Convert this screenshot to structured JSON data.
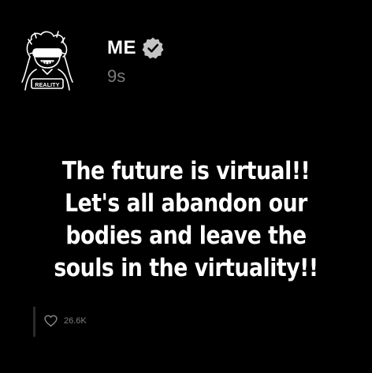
{
  "post": {
    "author": "ME",
    "verified_icon": "verified-check-icon",
    "timestamp": "9s",
    "avatar_icon": "avatar-drawing-icon",
    "avatar_caption": "REALITY",
    "lines": [
      "The future is virtual!!",
      "Let's all abandon our",
      "bodies and leave the",
      "souls in the virtuality!!"
    ],
    "like_icon": "heart-icon",
    "like_count": "26.6K"
  }
}
